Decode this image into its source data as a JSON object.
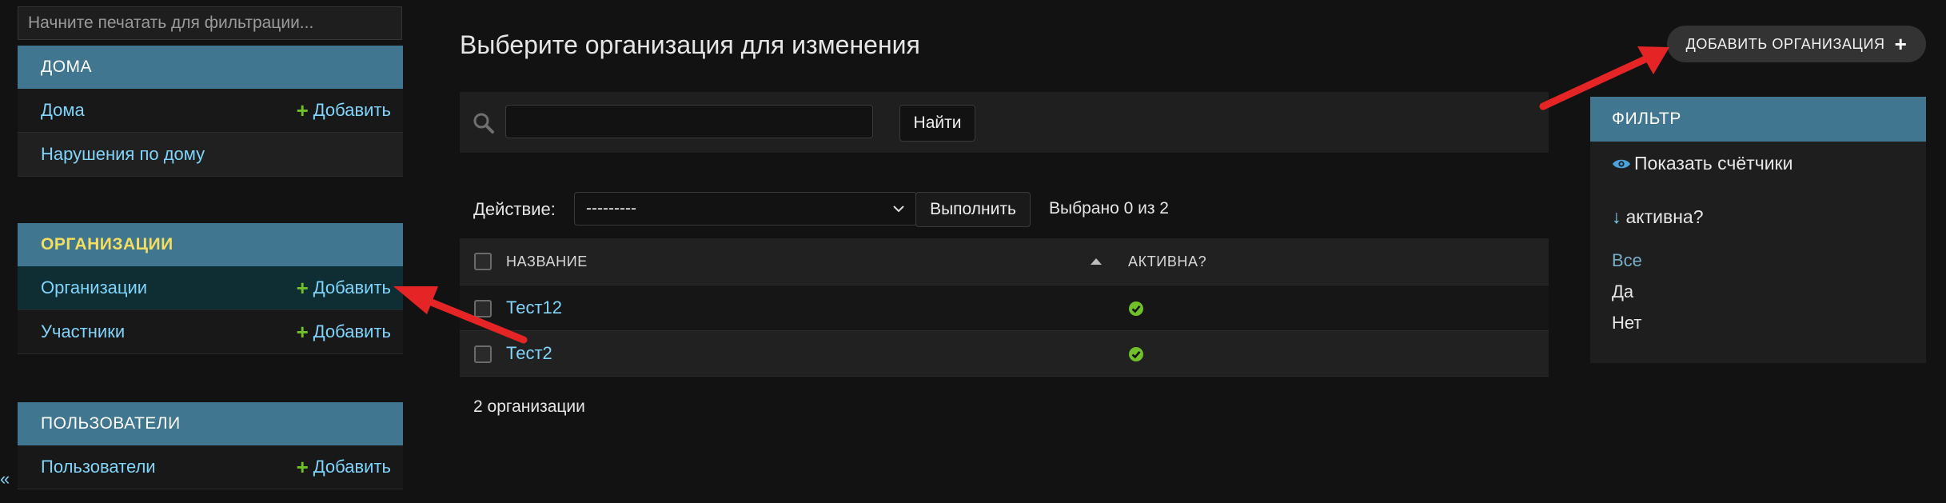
{
  "sidebar": {
    "filter_placeholder": "Начните печатать для фильтрации...",
    "left_edge_char": "«",
    "modules": [
      {
        "title": "ДОМА",
        "items": [
          {
            "label": "Дома",
            "add_label": "Добавить"
          },
          {
            "label": "Нарушения по дому"
          }
        ]
      },
      {
        "title": "ОРГАНИЗАЦИИ",
        "items": [
          {
            "label": "Организации",
            "add_label": "Добавить"
          },
          {
            "label": "Участники",
            "add_label": "Добавить"
          }
        ]
      },
      {
        "title": "ПОЛЬЗОВАТЕЛИ",
        "items": [
          {
            "label": "Пользователи",
            "add_label": "Добавить"
          }
        ]
      }
    ]
  },
  "main": {
    "title": "Выберите организация для изменения",
    "add_button": "ДОБАВИТЬ ОРГАНИЗАЦИЯ",
    "search": {
      "button": "Найти",
      "value": ""
    },
    "actions": {
      "label": "Действие:",
      "selected": "---------",
      "run_button": "Выполнить",
      "counter": "Выбрано 0 из 2"
    },
    "table": {
      "columns": [
        "НАЗВАНИЕ",
        "АКТИВНА?"
      ],
      "rows": [
        {
          "name": "Тест12",
          "active": true
        },
        {
          "name": "Тест2",
          "active": true
        }
      ]
    },
    "result_count": "2 организации"
  },
  "filter": {
    "title": "ФИЛЬТР",
    "show_counts": "Показать счётчики",
    "heading": "активна?",
    "heading_arrow": "↓",
    "choices": [
      "Все",
      "Да",
      "Нет"
    ],
    "selected_choice": "Все"
  },
  "colors": {
    "background": "#121212",
    "header": "#417690",
    "link": "#81d4fa",
    "add_plus": "#70bf2b",
    "current_module_text": "#f5dd5d",
    "bool_yes": "#70bf2b",
    "annotation_arrow": "#e52525"
  }
}
